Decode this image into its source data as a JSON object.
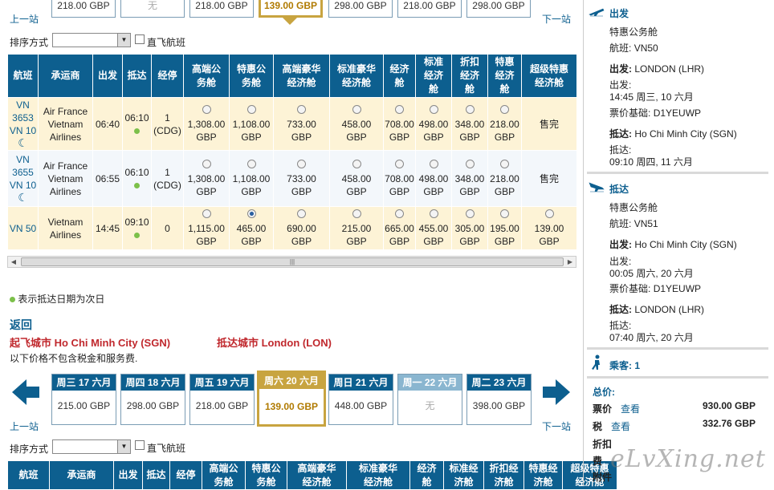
{
  "top_strip": {
    "prices": [
      "218.00 GBP",
      "无",
      "218.00 GBP",
      "139.00 GBP",
      "298.00 GBP",
      "218.00 GBP",
      "298.00 GBP"
    ],
    "selected_index": 3,
    "na_index": 1,
    "prev_label": "上一站",
    "next_label": "下一站"
  },
  "sort1": {
    "label": "排序方式",
    "direct_label": "直飞航班"
  },
  "table_headers": [
    "航班",
    "承运商",
    "出发",
    "抵达",
    "经停",
    "高端公务舱",
    "特惠公务舱",
    "高端豪华经济舱",
    "标准豪华经济舱",
    "经济舱",
    "标准经济舱",
    "折扣经济舱",
    "特惠经济舱",
    "超级特惠经济舱"
  ],
  "table1_headers": [
    "航班",
    "承运商",
    "出发",
    "抵达",
    "经停",
    "高端公\n务舱",
    "特惠公\n务舱",
    "高端豪华\n经济舱",
    "标准豪华\n经济舱",
    "经济\n舱",
    "标准\n经济\n舱",
    "折扣\n经济\n舱",
    "特惠\n经济\n舱",
    "超级特惠\n经济舱"
  ],
  "flights1": [
    {
      "flight": "VN\n3653\nVN 10",
      "carrier": "Air France\nVietnam\nAirlines",
      "dep": "06:40",
      "arr": "06:10",
      "stops": "1\n(CDG)",
      "fares": [
        "1,308.00\nGBP",
        "1,108.00\nGBP",
        "733.00\nGBP",
        "458.00\nGBP",
        "708.00\nGBP",
        "498.00\nGBP",
        "348.00\nGBP",
        "218.00\nGBP"
      ],
      "last": "售完",
      "next_day": true,
      "overnight": true
    },
    {
      "flight": "VN\n3655\nVN 10",
      "carrier": "Air France\nVietnam\nAirlines",
      "dep": "06:55",
      "arr": "06:10",
      "stops": "1\n(CDG)",
      "fares": [
        "1,308.00\nGBP",
        "1,108.00\nGBP",
        "733.00\nGBP",
        "458.00\nGBP",
        "708.00\nGBP",
        "498.00\nGBP",
        "348.00\nGBP",
        "218.00\nGBP"
      ],
      "last": "售完",
      "next_day": true,
      "overnight": true
    },
    {
      "flight": "VN 50",
      "carrier": "Vietnam\nAirlines",
      "dep": "14:45",
      "arr": "09:10",
      "stops": "0",
      "fares": [
        "1,115.00\nGBP",
        "465.00\nGBP",
        "690.00\nGBP",
        "215.00\nGBP",
        "665.00\nGBP",
        "455.00\nGBP",
        "305.00\nGBP",
        "195.00\nGBP",
        "139.00\nGBP"
      ],
      "last": "",
      "next_day": true,
      "overnight": false,
      "selected_fare": 1
    }
  ],
  "legend": "表示抵达日期为次日",
  "return": {
    "title": "返回",
    "from": "起飞城市 Ho Chi Minh City (SGN)",
    "to": "抵达城市 London (LON)",
    "note": "以下价格不包含税金和服务费."
  },
  "return_strip": {
    "dates": [
      {
        "day": "周三 17 六月",
        "price": "215.00 GBP"
      },
      {
        "day": "周四 18 六月",
        "price": "298.00 GBP"
      },
      {
        "day": "周五 19 六月",
        "price": "218.00 GBP"
      },
      {
        "day": "周六 20 六月",
        "price": "139.00 GBP"
      },
      {
        "day": "周日 21 六月",
        "price": "448.00 GBP"
      },
      {
        "day": "周一 22 六月",
        "price": "无"
      },
      {
        "day": "周二 23 六月",
        "price": "398.00 GBP"
      }
    ],
    "selected_index": 3,
    "na_index": 5,
    "prev_label": "上一站",
    "next_label": "下一站"
  },
  "sort2": {
    "label": "排序方式",
    "direct_label": "直飞航班"
  },
  "table2_headers": [
    "航班",
    "承运商",
    "出发",
    "抵达",
    "经停",
    "高端公\n务舱",
    "特惠公\n务舱",
    "高端豪华\n经济舱",
    "标准豪华\n经济舱",
    "经济\n舱",
    "标准经\n济舱",
    "折扣经\n济舱",
    "特惠经\n济舱",
    "超级特惠\n经济舱"
  ],
  "summary": {
    "depart_title": "出发",
    "depart": {
      "cabin": "特惠公务舱",
      "flight_label": "航班:",
      "flight": "VN50",
      "dep_label": "出发:",
      "dep_city": "LONDON (LHR)",
      "dep_time_label": "出发:",
      "dep_time": "14:45 周三, 10 六月",
      "fare_basis_label": "票价基础:",
      "fare_basis": "D1YEUWP",
      "arr_label": "抵达:",
      "arr_city": "Ho Chi Minh City (SGN)",
      "arr_time_label": "抵达:",
      "arr_time": "09:10 周四, 11 六月"
    },
    "arrive_title": "抵达",
    "arrive": {
      "cabin": "特惠公务舱",
      "flight_label": "航班:",
      "flight": "VN51",
      "dep_label": "出发:",
      "dep_city": "Ho Chi Minh City (SGN)",
      "dep_time_label": "出发:",
      "dep_time": "00:05 周六, 20 六月",
      "fare_basis_label": "票价基础:",
      "fare_basis": "D1YEUWP",
      "arr_label": "抵达:",
      "arr_city": "LONDON (LHR)",
      "arr_time_label": "抵达:",
      "arr_time": "07:40 周六, 20 六月"
    },
    "passengers_label": "乘客:",
    "passengers": "1",
    "total_label": "总价:",
    "fare_label": "票价",
    "fare_view": "查看",
    "fare_value": "930.00 GBP",
    "tax_label": "税",
    "tax_view": "查看",
    "tax_value": "332.76 GBP",
    "discount_label": "折扣",
    "fee_label": "费",
    "attach_label": "附件"
  },
  "watermark": "eLvXing.net",
  "colors": {
    "header_blue": "#0d5f8f",
    "selected_gold": "#c8a440",
    "row_yellow": "#fdf3d6",
    "red_text": "#c0282d"
  }
}
